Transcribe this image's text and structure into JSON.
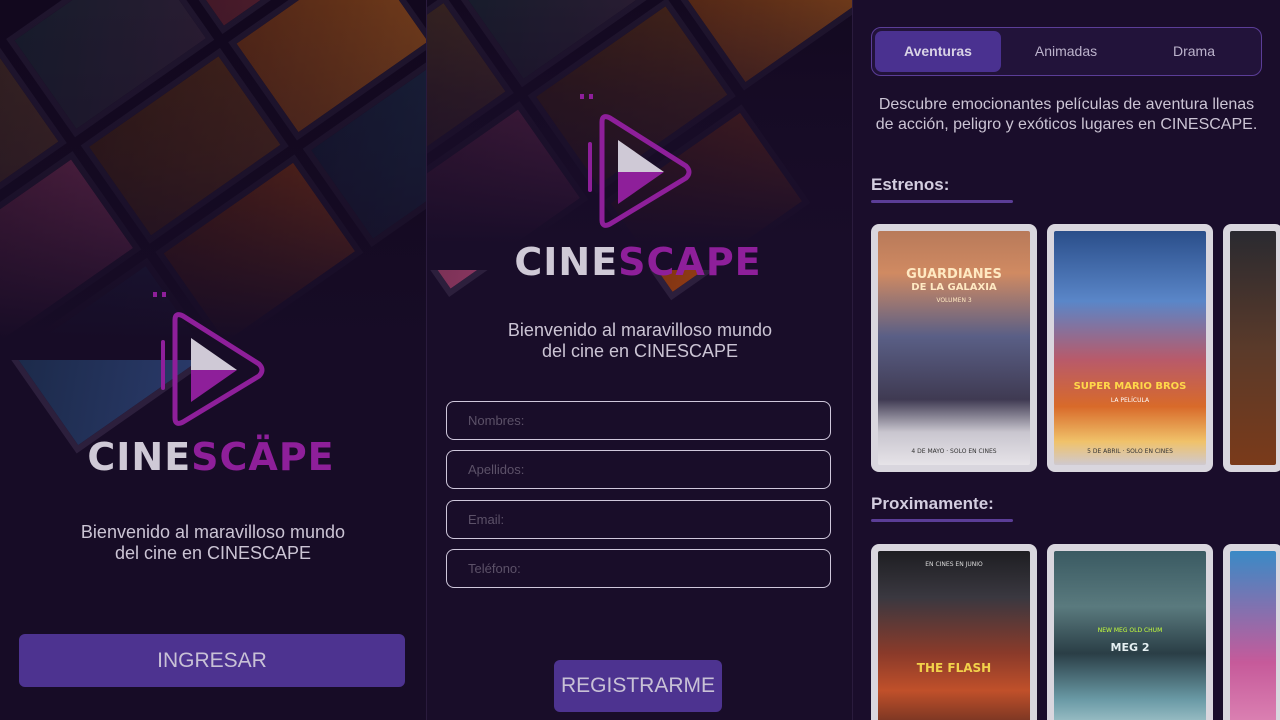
{
  "brand": {
    "name_part1": "CINE",
    "name_part2": "SCÄPE",
    "name_part2_alt": "SCAPE"
  },
  "colors": {
    "background": "#170c26",
    "accent": "#4d3390",
    "logo_purple": "#8e1f9a",
    "tab_border": "#5b3d97"
  },
  "welcome_screen": {
    "welcome_text_line1": "Bienvenido al maravilloso mundo",
    "welcome_text_line2": "del cine en CINESCAPE",
    "login_button": "INGRESAR"
  },
  "register_screen": {
    "welcome_text_line1": "Bienvenido al maravilloso mundo",
    "welcome_text_line2": "del cine en CINESCAPE",
    "fields": [
      {
        "placeholder": "Nombres:"
      },
      {
        "placeholder": "Apellidos:"
      },
      {
        "placeholder": "Email:"
      },
      {
        "placeholder": "Teléfono:"
      }
    ],
    "register_button": "REGISTRARME"
  },
  "catalog_screen": {
    "tabs": [
      {
        "label": "Aventuras",
        "active": true
      },
      {
        "label": "Animadas",
        "active": false
      },
      {
        "label": "Drama",
        "active": false
      }
    ],
    "description": "Descubre emocionantes películas de aventura llenas de acción, peligro y exóticos lugares en CINESCAPE.",
    "premieres_title": "Estrenos:",
    "upcoming_title": "Proximamente:",
    "premieres": [
      {
        "title_line1": "GUARDIANES",
        "title_line2": "DE LA GALAXIA",
        "subtitle": "VOLUMEN 3",
        "footer": "4 DE MAYO · SOLO EN CINES"
      },
      {
        "title_line1": "SUPER MARIO BROS",
        "title_line2": "LA PELÍCULA",
        "subtitle": "",
        "footer": "5 DE ABRIL · SOLO EN CINES"
      }
    ],
    "upcoming": [
      {
        "title_line1": "THE FLASH",
        "subtitle": "EN CINES EN JUNIO"
      },
      {
        "title_line1": "MEG 2",
        "subtitle": "NEW MEG OLD CHUM"
      }
    ]
  },
  "icons": [
    "play-logo-icon"
  ]
}
